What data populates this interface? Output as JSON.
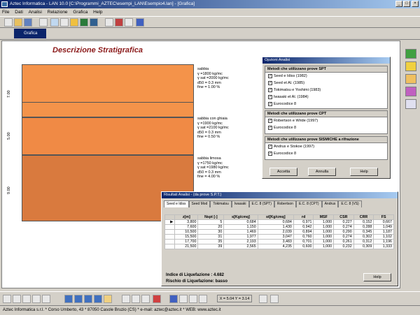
{
  "window": {
    "title": "Aztec Informatica - LAN 10.0 [C:\\Programmi_AZTEC\\esempi_LAN\\Esempio4.lan] - [Grafica]",
    "min": "_",
    "max": "□",
    "close": "×"
  },
  "menu": [
    "File",
    "Dati",
    "Analisi",
    "Relazione",
    "Grafica",
    "Help"
  ],
  "toolbar2": {
    "grafica_label": "Grafica"
  },
  "drawing": {
    "title": "Descrizione Stratigrafica",
    "layers": [
      {
        "thickness_label": "7.00",
        "color": "#f4934a",
        "desc": [
          "sabbia",
          "γ =1800 kg/mc",
          "γ sat =2000 kg/mc",
          "d50 = 0.3 mm",
          "fine = 1.00 %"
        ]
      },
      {
        "thickness_label": "5.00",
        "color": "#f08a45",
        "desc": [
          "sabbia con ghiaia",
          "γ =1900 kg/mc",
          "γ sat =2100 kg/mc",
          "d50 = 0.3 mm",
          "fine = 0.50 %"
        ]
      },
      {
        "thickness_label": "9.00",
        "color": "#d97a3e",
        "desc": [
          "sabbia limosa",
          "γ =1750 kg/mc",
          "γ sat =1980 kg/mc",
          "d50 = 0.3 mm",
          "fine = 4.00 %"
        ]
      }
    ]
  },
  "options_dialog": {
    "title": "Opzioni Analisi",
    "spt_title": "Metodi che utilizzano prove SPT",
    "spt_methods": [
      "Seed e Idiss (1982)",
      "Seed et Al. (1985)",
      "Tokimatsu e Yoshimi (1983)",
      "Iwasaki et Al. (1984)",
      "Eurocodice 8"
    ],
    "cpt_title": "Metodi che utilizzano prove CPT",
    "cpt_methods": [
      "Robertson e Wride (1997)",
      "Eurocodice 8"
    ],
    "sism_title": "Metodi che utilizzano prove SISMICHE a rifrazione",
    "sism_methods": [
      "Andrus e Stokoe (1997)",
      "Eurocodice 8"
    ],
    "check_mark": "✓",
    "ok": "Accetta",
    "cancel": "Annulla",
    "help": "Help"
  },
  "results_dialog": {
    "title": "Risultati Analisi - (da prove S.P.T.)",
    "tabs": [
      "Seed e Idiss",
      "Seed Mod",
      "Tokimatsu",
      "Iwasaki",
      "E.C. 8 (SPT)",
      "Robertson",
      "E.C. 8 (CPT)",
      "Andrus",
      "E.C. 8 (VS)"
    ],
    "headers": [
      "",
      "z[m]",
      "Nspt [-]",
      "s[Kg/cmq]",
      "st[Kg/cmq]",
      "rd",
      "MSF",
      "CSR",
      "CRR",
      "FS"
    ],
    "rows": [
      [
        "▶",
        "3,800",
        "5",
        "0,684",
        "0,684",
        "0,971",
        "1,000",
        "0,227",
        "0,152",
        "0,667"
      ],
      [
        "",
        "7,600",
        "20",
        "1,150",
        "1,430",
        "0,942",
        "1,000",
        "0,274",
        "0,288",
        "1,049"
      ],
      [
        "",
        "10,500",
        "30",
        "1,469",
        "2,039",
        "0,894",
        "1,000",
        "0,290",
        "0,345",
        "1,187"
      ],
      [
        "",
        "15,500",
        "31",
        "1,977",
        "3,047",
        "0,760",
        "1,000",
        "0,274",
        "0,302",
        "1,102"
      ],
      [
        "",
        "17,700",
        "35",
        "2,193",
        "3,483",
        "0,701",
        "1,000",
        "0,261",
        "0,312",
        "1,196"
      ],
      [
        "",
        "21,500",
        "39",
        "2,565",
        "4,235",
        "0,600",
        "1,000",
        "0,232",
        "0,309",
        "1,333"
      ]
    ],
    "index_label": "Indice di Liquefazione   :  4.682",
    "risk_label": "Rischio di Liquefazione: basso",
    "help": "Help"
  },
  "coords": "X = 5.04  Y = 3.14",
  "statusbar": "Aztec Informatica s.r.l. * Corso Umberto, 43 * 87050 Casole Bruzio (CS) * e-mail: aztec@aztec.it * WEB: www.aztec.it"
}
